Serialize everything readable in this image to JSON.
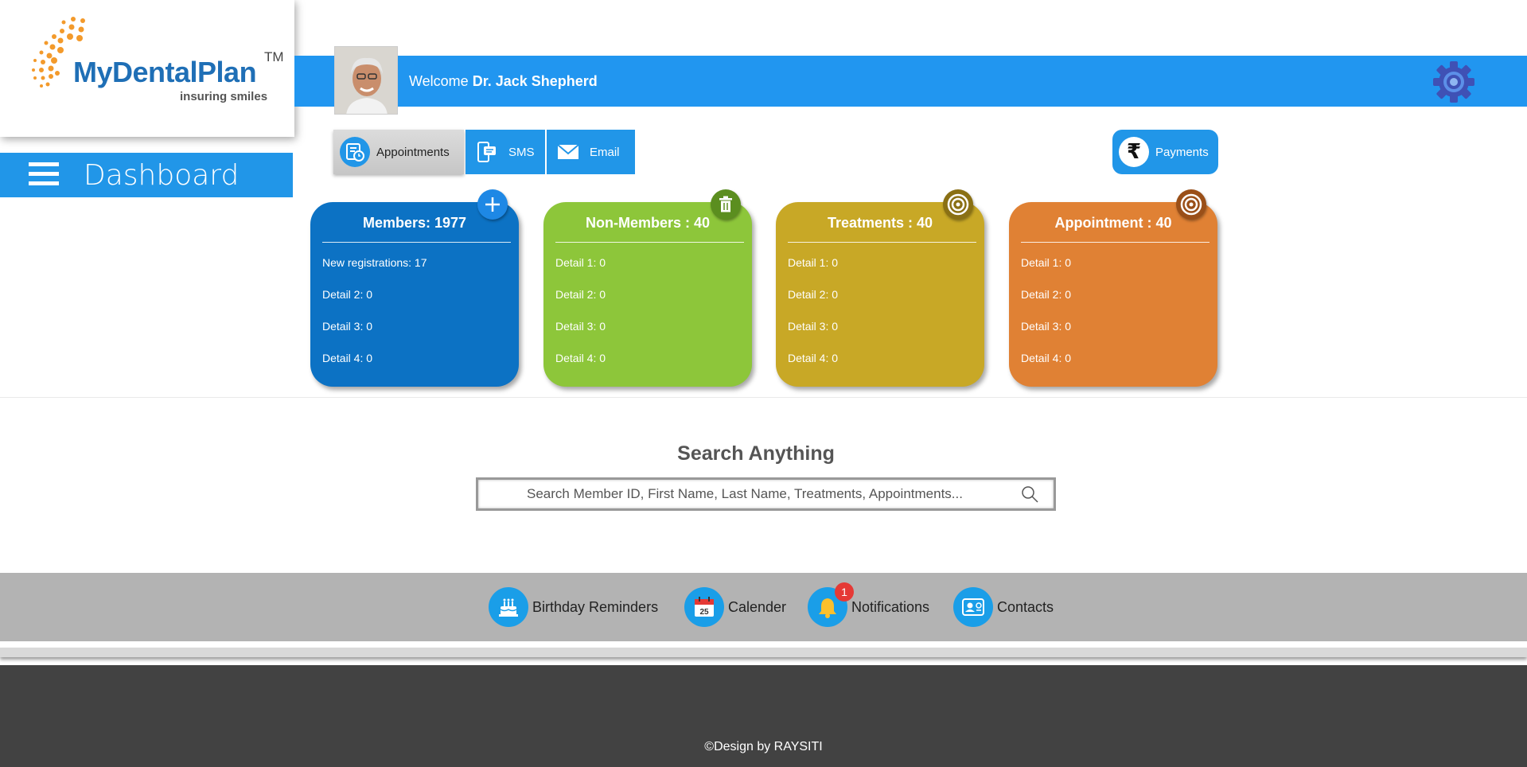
{
  "logo": {
    "brand": "MyDentalPlan",
    "trademark": "TM",
    "tagline": "insuring smiles"
  },
  "sidebar": {
    "title": "Dashboard"
  },
  "header": {
    "welcome_prefix": "Welcome",
    "user_name": "Dr. Jack Shepherd"
  },
  "actions": {
    "appointments": "Appointments",
    "sms": "SMS",
    "email": "Email",
    "payments": "Payments"
  },
  "cards": [
    {
      "title": "Members: 1977",
      "rows": [
        "New registrations: 17",
        "Detail 2: 0",
        "Detail 3: 0",
        "Detail 4: 0"
      ],
      "badge_icon": "plus-icon"
    },
    {
      "title": "Non-Members : 40",
      "rows": [
        "Detail 1: 0",
        "Detail 2: 0",
        "Detail 3: 0",
        "Detail 4: 0"
      ],
      "badge_icon": "trash-icon"
    },
    {
      "title": "Treatments : 40",
      "rows": [
        "Detail 1: 0",
        "Detail 2: 0",
        "Detail 3: 0",
        "Detail 4: 0"
      ],
      "badge_icon": "target-icon"
    },
    {
      "title": "Appointment : 40",
      "rows": [
        "Detail 1: 0",
        "Detail 2: 0",
        "Detail 3: 0",
        "Detail 4: 0"
      ],
      "badge_icon": "target-icon"
    }
  ],
  "search": {
    "title": "Search Anything",
    "placeholder": "Search Member ID, First Name, Last Name, Treatments, Appointments..."
  },
  "quick_links": {
    "birthday": "Birthday Reminders",
    "calender": "Calender",
    "calender_day": "25",
    "notifications": "Notifications",
    "notifications_count": "1",
    "contacts": "Contacts"
  },
  "footer": {
    "credit": "©Design by RAYSITI"
  },
  "colors": {
    "primary_blue": "#2196f0",
    "members": "#0c72c4",
    "non_members": "#8dc63a",
    "treatments": "#c8a826",
    "appointment": "#e08134",
    "footer": "#424242"
  }
}
